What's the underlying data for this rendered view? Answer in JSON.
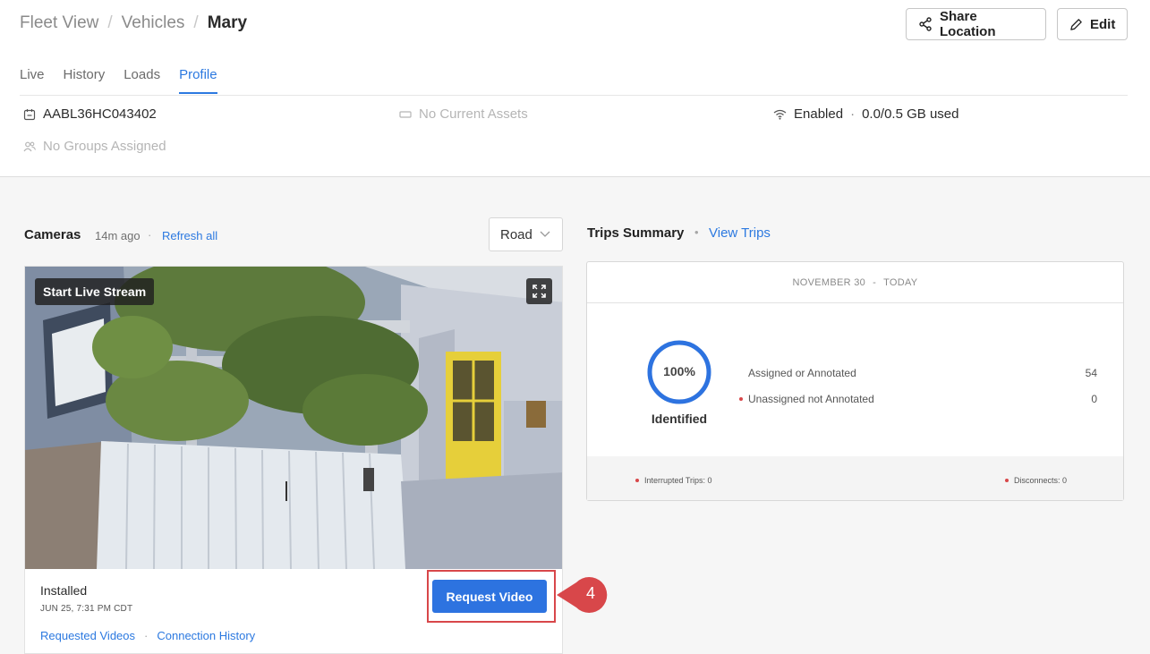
{
  "breadcrumb": {
    "root": "Fleet View",
    "middle": "Vehicles",
    "current": "Mary",
    "separator": "/"
  },
  "header_actions": {
    "share_label": "Share Location",
    "edit_label": "Edit"
  },
  "tabs": [
    {
      "label": "Live",
      "active": false
    },
    {
      "label": "History",
      "active": false
    },
    {
      "label": "Loads",
      "active": false
    },
    {
      "label": "Profile",
      "active": true
    }
  ],
  "vehicle_info": {
    "device_id": "AABL36HC043402",
    "assets": "No Current Assets",
    "groups": "No Groups Assigned",
    "wifi_status": "Enabled",
    "wifi_separator": "·",
    "data_usage": "0.0/0.5 GB used"
  },
  "cameras": {
    "title": "Cameras",
    "updated": "14m ago",
    "separator": "·",
    "refresh_label": "Refresh all",
    "view_select": "Road",
    "live_stream_label": "Start Live Stream",
    "status": "Installed",
    "install_date": "JUN 25, 7:31 PM CDT",
    "links": {
      "requested_videos": "Requested Videos",
      "separator": "·",
      "connection_history": "Connection History"
    },
    "request_video_label": "Request Video"
  },
  "callout": {
    "step": "4"
  },
  "trips": {
    "title": "Trips Summary",
    "separator": "•",
    "view_trips_label": "View Trips",
    "date_start": "NOVEMBER 30",
    "date_sep": "-",
    "date_end": "TODAY",
    "percent_identified": 100,
    "percent_label": "100%",
    "identified_label": "Identified",
    "assigned_label": "Assigned or Annotated",
    "assigned_value": "54",
    "unassigned_label": "Unassigned not Annotated",
    "unassigned_value": "0",
    "interrupted": "Interrupted Trips: 0",
    "disconnects": "Disconnects: 0"
  },
  "colors": {
    "accent": "#2c79e0",
    "primary_button": "#2d73e0",
    "callout": "#d8474a",
    "ring": "#2d73e0"
  }
}
